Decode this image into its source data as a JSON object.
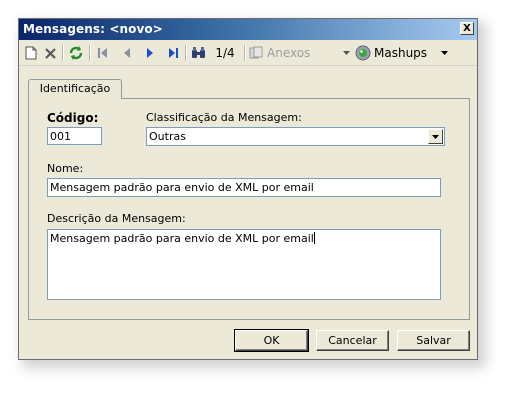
{
  "window": {
    "title": "Mensagens: <novo>",
    "close_glyph": "X"
  },
  "toolbar": {
    "record_position": "1/4",
    "attachments_label": "Anexos",
    "mashups_label": "Mashups",
    "icons": [
      "new-document-icon",
      "delete-icon",
      "refresh-icon",
      "first-record-icon",
      "previous-record-icon",
      "next-record-icon",
      "last-record-icon",
      "search-icon",
      "attachment-icon",
      "mashups-icon"
    ]
  },
  "tabs": [
    {
      "label": "Identificação",
      "active": true
    }
  ],
  "form": {
    "code_label": "Código:",
    "code_value": "001",
    "classification_label": "Classificação da Mensagem:",
    "classification_value": "Outras",
    "name_label": "Nome:",
    "name_value": "Mensagem padrão para envio de XML por email",
    "description_label": "Descrição da Mensagem:",
    "description_value": "Mensagem padrão para envio de XML por email"
  },
  "buttons": {
    "ok": "OK",
    "cancel": "Cancelar",
    "save": "Salvar"
  },
  "colors": {
    "title_bar_start": "#0a246a",
    "title_bar_end": "#a6caf0",
    "window_face": "#ece9d8",
    "input_border": "#7f9db9"
  }
}
